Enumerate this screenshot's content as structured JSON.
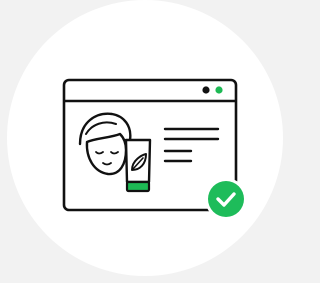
{
  "illustration": {
    "window_dots": [
      "dark-dot",
      "green-dot"
    ],
    "content_lines": 4,
    "status": "check-mark"
  },
  "colors": {
    "background": "#f2f2f2",
    "circle": "#ffffff",
    "stroke": "#111111",
    "accent": "#1db954",
    "check_bg": "#1ebc5a"
  }
}
